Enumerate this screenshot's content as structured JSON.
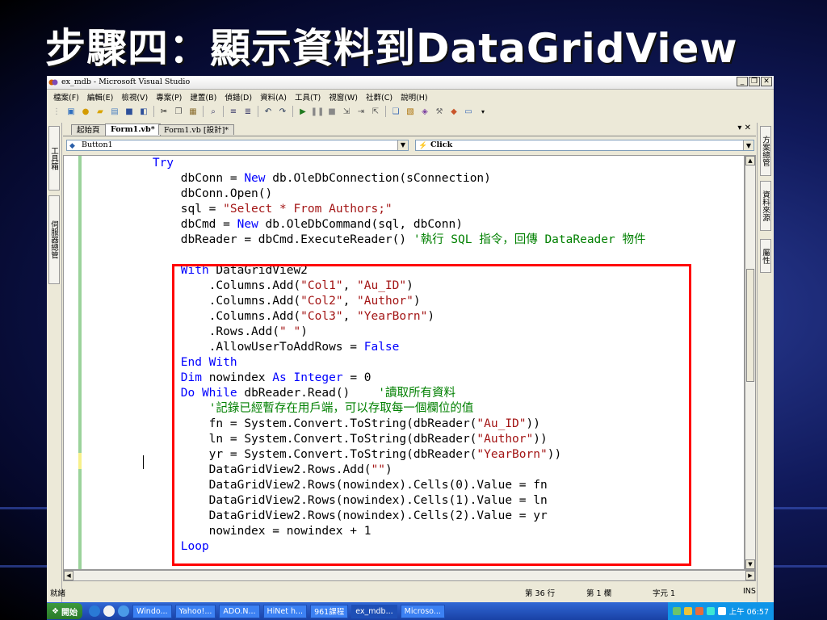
{
  "slide": {
    "title": "步驟四：顯示資料到DataGridView"
  },
  "window": {
    "title": "ex_mdb - Microsoft Visual Studio",
    "controls": {
      "minimize": "_",
      "maximize": "❐",
      "close": "✕"
    }
  },
  "menu": [
    "檔案(F)",
    "編輯(E)",
    "檢視(V)",
    "專案(P)",
    "建置(B)",
    "偵錯(D)",
    "資料(A)",
    "工具(T)",
    "視窗(W)",
    "社群(C)",
    "說明(H)"
  ],
  "left_dock": {
    "toolbox": "工具箱",
    "server_explorer": "伺服器總管"
  },
  "right_dock": {
    "solution_explorer": "方案總管",
    "data_sources": "資料來源",
    "properties": "屬性"
  },
  "doc_tabs": [
    {
      "label": "起始頁",
      "active": false
    },
    {
      "label": "Form1.vb*",
      "active": true
    },
    {
      "label": "Form1.vb [設計]*",
      "active": false
    }
  ],
  "doc_tab_controls": "▾ ✕",
  "nav": {
    "object": "Button1",
    "event": "Click"
  },
  "code_lines": [
    [
      [
        "",
        "        "
      ],
      [
        "kw",
        "Try"
      ]
    ],
    [
      [
        "",
        "            dbConn = "
      ],
      [
        "kw",
        "New"
      ],
      [
        "",
        " db.OleDbConnection(sConnection)"
      ]
    ],
    [
      [
        "",
        "            dbConn.Open()"
      ]
    ],
    [
      [
        "",
        "            sql = "
      ],
      [
        "st",
        "\"Select * From Authors;\""
      ]
    ],
    [
      [
        "",
        "            dbCmd = "
      ],
      [
        "kw",
        "New"
      ],
      [
        "",
        " db.OleDbCommand(sql, dbConn)"
      ]
    ],
    [
      [
        "",
        "            dbReader = dbCmd.ExecuteReader() "
      ],
      [
        "cm",
        "'執行 SQL 指令，回傳 DataReader 物件"
      ]
    ],
    [
      [
        "",
        ""
      ]
    ],
    [
      [
        "",
        "            "
      ],
      [
        "kw",
        "With"
      ],
      [
        "",
        " DataGridView2"
      ]
    ],
    [
      [
        "",
        "                .Columns.Add("
      ],
      [
        "st",
        "\"Col1\""
      ],
      [
        "",
        ", "
      ],
      [
        "st",
        "\"Au_ID\""
      ],
      [
        "",
        ")"
      ]
    ],
    [
      [
        "",
        "                .Columns.Add("
      ],
      [
        "st",
        "\"Col2\""
      ],
      [
        "",
        ", "
      ],
      [
        "st",
        "\"Author\""
      ],
      [
        "",
        ")"
      ]
    ],
    [
      [
        "",
        "                .Columns.Add("
      ],
      [
        "st",
        "\"Col3\""
      ],
      [
        "",
        ", "
      ],
      [
        "st",
        "\"YearBorn\""
      ],
      [
        "",
        ")"
      ]
    ],
    [
      [
        "",
        "                .Rows.Add("
      ],
      [
        "st",
        "\" \""
      ],
      [
        "",
        ")"
      ]
    ],
    [
      [
        "",
        "                .AllowUserToAddRows = "
      ],
      [
        "kw",
        "False"
      ]
    ],
    [
      [
        "",
        "            "
      ],
      [
        "kw",
        "End With"
      ]
    ],
    [
      [
        "",
        "            "
      ],
      [
        "kw",
        "Dim"
      ],
      [
        "",
        " nowindex "
      ],
      [
        "kw",
        "As"
      ],
      [
        "",
        " "
      ],
      [
        "kw",
        "Integer"
      ],
      [
        "",
        " = 0"
      ]
    ],
    [
      [
        "",
        "            "
      ],
      [
        "kw",
        "Do While"
      ],
      [
        "",
        " dbReader.Read()    "
      ],
      [
        "cm",
        "'讀取所有資料"
      ]
    ],
    [
      [
        "",
        "                "
      ],
      [
        "cm",
        "'記錄已經暫存在用戶端，可以存取每一個欄位的值"
      ]
    ],
    [
      [
        "",
        "                fn = System.Convert.ToString(dbReader("
      ],
      [
        "st",
        "\"Au_ID\""
      ],
      [
        "",
        "))"
      ]
    ],
    [
      [
        "",
        "                ln = System.Convert.ToString(dbReader("
      ],
      [
        "st",
        "\"Author\""
      ],
      [
        "",
        "))"
      ]
    ],
    [
      [
        "",
        "                yr = System.Convert.ToString(dbReader("
      ],
      [
        "st",
        "\"YearBorn\""
      ],
      [
        "",
        "))"
      ]
    ],
    [
      [
        "",
        "                DataGridView2.Rows.Add("
      ],
      [
        "st",
        "\"\""
      ],
      [
        "",
        ")"
      ]
    ],
    [
      [
        "",
        "                DataGridView2.Rows(nowindex).Cells(0).Value = fn"
      ]
    ],
    [
      [
        "",
        "                DataGridView2.Rows(nowindex).Cells(1).Value = ln"
      ]
    ],
    [
      [
        "",
        "                DataGridView2.Rows(nowindex).Cells(2).Value = yr"
      ]
    ],
    [
      [
        "",
        "                nowindex = nowindex + 1"
      ]
    ],
    [
      [
        "",
        "            "
      ],
      [
        "kw",
        "Loop"
      ]
    ]
  ],
  "status": {
    "ready": "就緒",
    "line": "第 36 行",
    "column": "第 1 欄",
    "char": "字元 1",
    "mode": "INS"
  },
  "taskbar": {
    "start": "開始",
    "buttons": [
      "Windo...",
      "Yahoo!...",
      "ADO.N...",
      "HiNet h...",
      "961課程",
      "ex_mdb...",
      "Microso..."
    ],
    "active_index": 5,
    "clock": "上午 06:57"
  },
  "colors": {
    "keyword": "#0000ff",
    "string": "#a31515",
    "comment": "#008000",
    "highlight_box": "#ff0000"
  }
}
